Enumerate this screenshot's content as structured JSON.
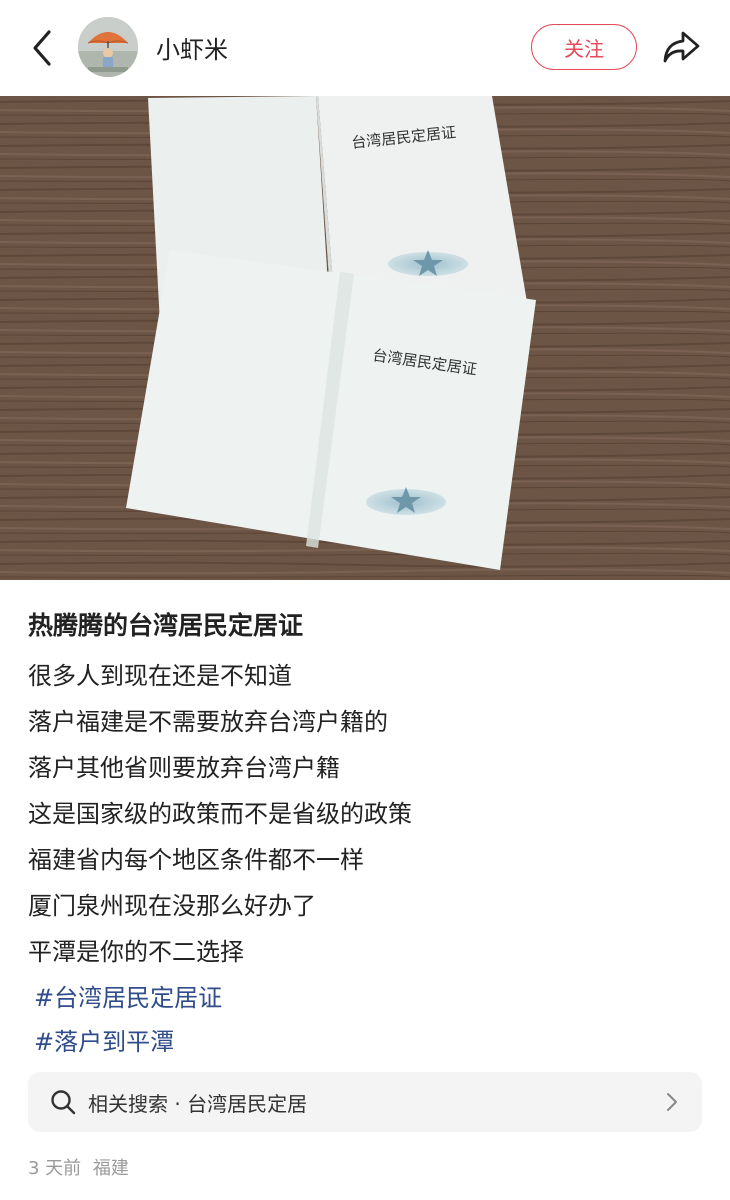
{
  "header": {
    "username": "小虾米",
    "follow_label": "关注",
    "avatar_caption": "雨伞男孩"
  },
  "photo": {
    "card_text_top": "台湾居民定居证",
    "card_text_bottom": "台湾居民定居证"
  },
  "post": {
    "title": "热腾腾的台湾居民定居证",
    "lines": [
      "很多人到现在还是不知道",
      "落户福建是不需要放弃台湾户籍的",
      "落户其他省则要放弃台湾户籍",
      "这是国家级的政策而不是省级的政策",
      "福建省内每个地区条件都不一样",
      "厦门泉州现在没那么好办了",
      "平潭是你的不二选择"
    ],
    "tags": [
      "#台湾居民定居证",
      "#落户到平潭"
    ]
  },
  "related_search": {
    "text": "相关搜索 · 台湾居民定居"
  },
  "meta": {
    "time": "3 天前",
    "location": "福建"
  },
  "colors": {
    "accent": "#e64a59",
    "tag": "#2f4d8a",
    "muted": "#9a9a9a"
  }
}
